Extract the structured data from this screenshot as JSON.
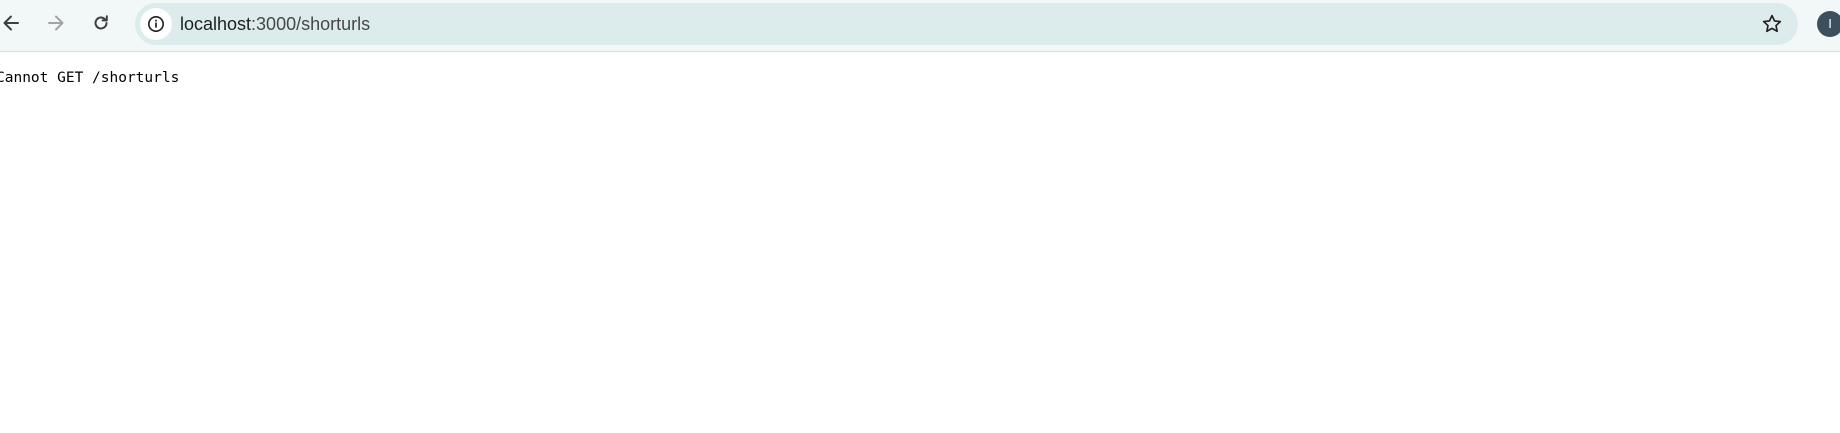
{
  "browser": {
    "nav": {
      "back_icon": "arrow-left-icon",
      "forward_icon": "arrow-right-icon",
      "reload_icon": "reload-icon"
    },
    "address_bar": {
      "site_info_icon": "info-circle-icon",
      "url_host": "localhost",
      "url_path": ":3000/shorturls",
      "bookmark_icon": "star-outline-icon"
    },
    "profile": {
      "initial": "I",
      "color": "#3b4f5c"
    },
    "colors": {
      "toolbar_bg": "#f2f8f8",
      "omnibox_bg": "#dcebeb"
    }
  },
  "page": {
    "error_message": "Cannot GET /shorturls"
  }
}
